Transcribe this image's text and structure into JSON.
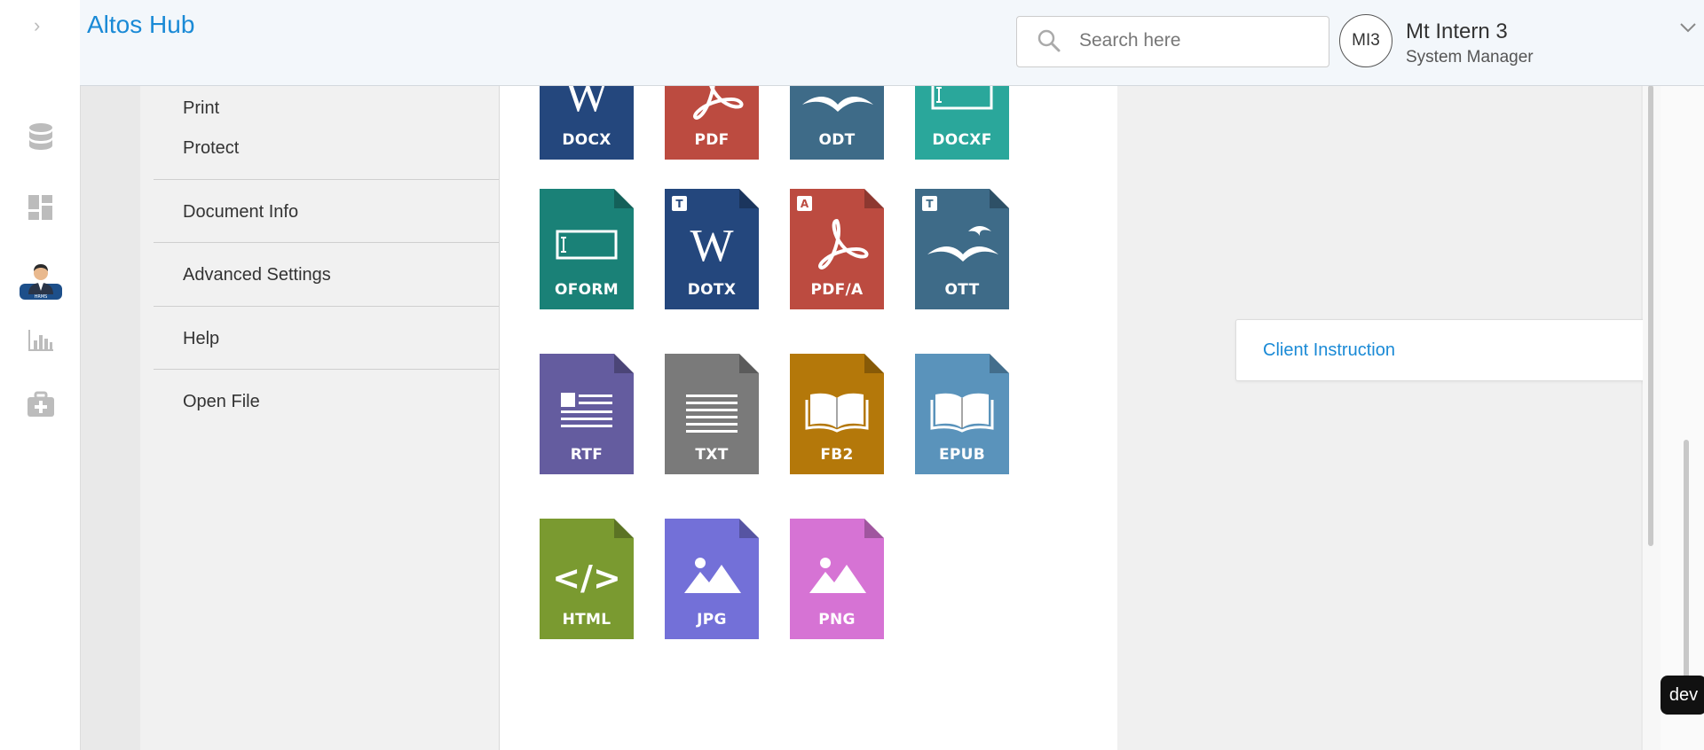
{
  "app": {
    "title": "Altos Hub"
  },
  "search": {
    "placeholder": "Search here"
  },
  "user": {
    "initials": "MI3",
    "name": "Mt Intern 3",
    "role": "System Manager"
  },
  "rail": {
    "icons": [
      "chevron-right-icon",
      "database-icon",
      "dashboard-icon",
      "user-avatar-icon",
      "bar-chart-icon",
      "medical-kit-icon"
    ],
    "avatar_caption": "HRMS"
  },
  "menu": {
    "items": [
      {
        "label": "Print"
      },
      {
        "label": "Protect"
      },
      {
        "label": "Document Info"
      },
      {
        "label": "Advanced Settings"
      },
      {
        "label": "Help"
      },
      {
        "label": "Open File"
      }
    ]
  },
  "files": [
    {
      "label": "DOCX",
      "color": "#24477d",
      "glyph": "W",
      "badge": ""
    },
    {
      "label": "PDF",
      "color": "#bc4b40",
      "glyph": "acrobat",
      "badge": ""
    },
    {
      "label": "ODT",
      "color": "#3e6b88",
      "glyph": "gulls",
      "badge": ""
    },
    {
      "label": "DOCXF",
      "color": "#2aa79b",
      "glyph": "form",
      "badge": ""
    },
    {
      "label": "OFORM",
      "color": "#1a8177",
      "glyph": "form",
      "badge": ""
    },
    {
      "label": "DOTX",
      "color": "#24477d",
      "glyph": "W",
      "badge": "T"
    },
    {
      "label": "PDF/A",
      "color": "#bc4b40",
      "glyph": "acrobat",
      "badge": "A"
    },
    {
      "label": "OTT",
      "color": "#3e6b88",
      "glyph": "gulls",
      "badge": "T"
    },
    {
      "label": "RTF",
      "color": "#645c9f",
      "glyph": "rtf",
      "badge": ""
    },
    {
      "label": "TXT",
      "color": "#7a7a7a",
      "glyph": "lines",
      "badge": ""
    },
    {
      "label": "FB2",
      "color": "#b4780a",
      "glyph": "book",
      "badge": ""
    },
    {
      "label": "EPUB",
      "color": "#5a93bb",
      "glyph": "book",
      "badge": ""
    },
    {
      "label": "HTML",
      "color": "#7a9a30",
      "glyph": "code",
      "badge": ""
    },
    {
      "label": "JPG",
      "color": "#7370d8",
      "glyph": "image",
      "badge": ""
    },
    {
      "label": "PNG",
      "color": "#d673d4",
      "glyph": "image",
      "badge": ""
    }
  ],
  "client_instruction": {
    "label": "Client Instruction"
  },
  "dev_badge": {
    "label": "dev"
  },
  "colors": {
    "accent": "#1a8ad6"
  }
}
